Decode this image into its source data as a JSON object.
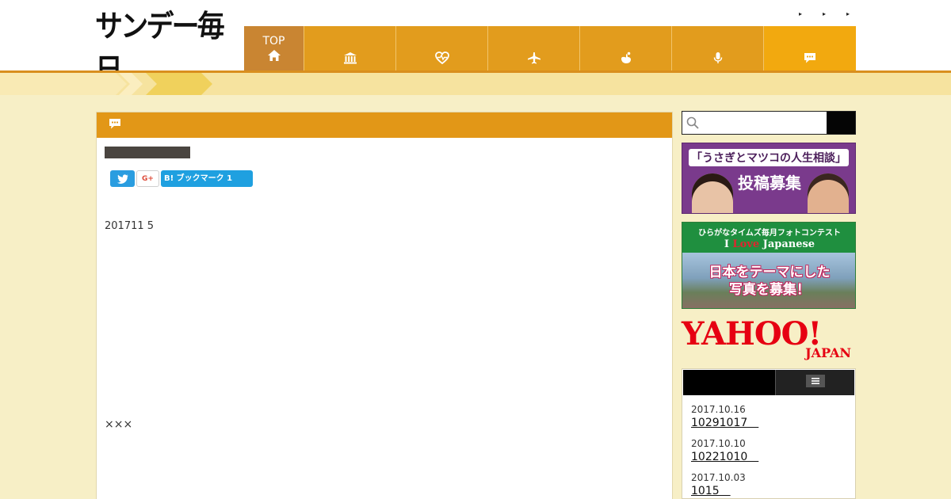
{
  "header": {
    "logo_text": "サンデー毎日",
    "top_links": [
      "▸",
      "▸",
      "▸"
    ],
    "nav": [
      {
        "label": "TOP",
        "icon": "home-icon"
      },
      {
        "label": "",
        "icon": "building-icon"
      },
      {
        "label": "",
        "icon": "health-icon"
      },
      {
        "label": "",
        "icon": "airplane-icon"
      },
      {
        "label": "",
        "icon": "hand-icon"
      },
      {
        "label": "",
        "icon": "microphone-icon"
      },
      {
        "label": "",
        "icon": "comment-icon"
      }
    ]
  },
  "article": {
    "share": {
      "gplus_label": "G+",
      "hatena_label": "B! ブックマーク 1"
    },
    "date_text": "201711 5",
    "body_text": "×××"
  },
  "sidebar": {
    "search_placeholder": "",
    "banner1": {
      "line1": "「うさぎとマツコの人生相談」",
      "line2": "投稿募集"
    },
    "banner2": {
      "sub": "ひらがなタイムズ毎月フォトコンテスト",
      "title_pre": "I ",
      "title_love": "Love",
      "title_post": " Japanese",
      "main_line1": "日本をテーマにした",
      "main_line2": "写真を募集！"
    },
    "banner3": {
      "main": "YAHOO!",
      "sub": "JAPAN"
    },
    "news": [
      {
        "date": "2017.10.16",
        "title": "10291017　"
      },
      {
        "date": "2017.10.10",
        "title": "10221010　"
      },
      {
        "date": "2017.10.03",
        "title": "1015　"
      }
    ]
  },
  "colors": {
    "nav_top": "#c98532",
    "nav_mid": "#e29c1d",
    "nav_last": "#f2a90f",
    "section_header": "#e29717",
    "background": "#f7efc6",
    "twitter": "#2a9de0",
    "hatena": "#1fa0e0",
    "yahoo_red": "#e60012"
  }
}
